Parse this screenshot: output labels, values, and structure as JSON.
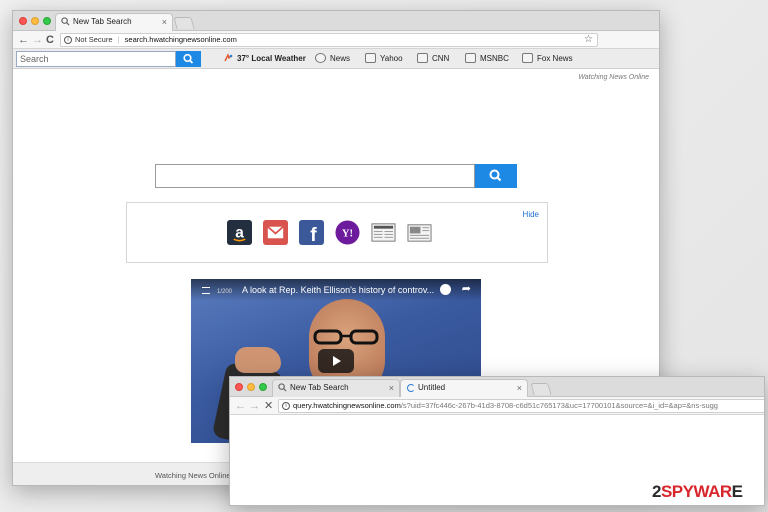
{
  "main_window": {
    "tab": {
      "title": "New Tab Search",
      "close": "×"
    },
    "address": {
      "secure_label": "Not Secure",
      "separator": "|",
      "url": "search.hwatchingnewsonline.com",
      "star": "☆"
    },
    "nav": {
      "back": "←",
      "forward": "→",
      "reload": "C"
    },
    "extension_bar": {
      "search_placeholder": "Search",
      "links": [
        {
          "label": "37° Local Weather",
          "icon": "weather-icon"
        },
        {
          "label": "News",
          "icon": "news-icon"
        },
        {
          "label": "Yahoo",
          "icon": "yahoo-icon"
        },
        {
          "label": "CNN",
          "icon": "cnn-icon"
        },
        {
          "label": "MSNBC",
          "icon": "msnbc-icon"
        },
        {
          "label": "Fox News",
          "icon": "foxnews-icon"
        }
      ]
    },
    "brand_text": "Watching News Online",
    "main_search": {
      "value": ""
    },
    "shortcuts": {
      "hide_label": "Hide",
      "items": [
        {
          "name": "amazon",
          "letter": "a",
          "color": "#232f3e"
        },
        {
          "name": "gmail",
          "letter": "",
          "color": "#d9534f"
        },
        {
          "name": "facebook",
          "letter": "f",
          "color": "#3b5998"
        },
        {
          "name": "yahoo",
          "letter": "Y!",
          "color": "#6d1b9c"
        },
        {
          "name": "newspaper-1",
          "letter": "",
          "color": "#888888"
        },
        {
          "name": "newspaper-2",
          "letter": "",
          "color": "#888888"
        }
      ]
    },
    "video": {
      "counter": "1/200",
      "title": "A look at Rep. Keith Ellison's history of controv..."
    },
    "footer_text": "Watching News Online"
  },
  "second_window": {
    "tabs": [
      {
        "title": "New Tab Search",
        "close": "×"
      },
      {
        "title": "Untitled",
        "close": "×"
      }
    ],
    "nav": {
      "back": "←",
      "forward": "→",
      "stop": "✕"
    },
    "address": {
      "host": "query.hwatchingnewsonline.com",
      "path": "/s?uid=37fc446c-267b-41d3-8708-c6d51c765173&uc=17700101&source=&i_id=&ap=&ns-sugg"
    }
  },
  "watermark": {
    "prefix": "2",
    "accent": "SPYWAR",
    "suffix": "E"
  },
  "colors": {
    "accent_blue": "#1e88e5",
    "link_blue": "#1e6fd0",
    "watermark_red": "#d8262d"
  }
}
